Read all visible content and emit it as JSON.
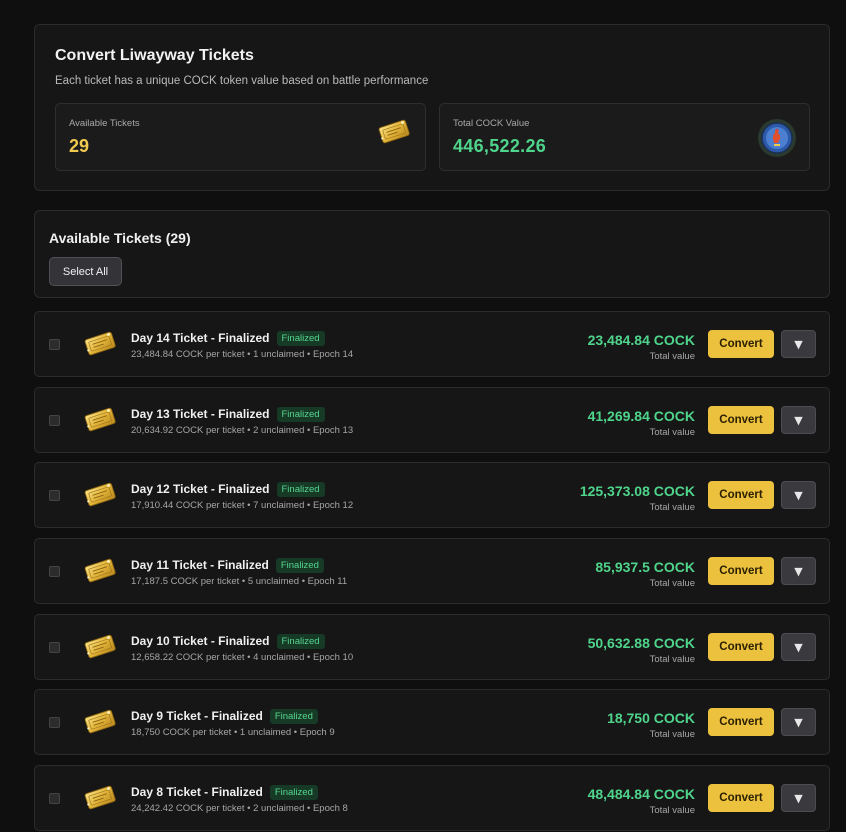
{
  "header": {
    "title": "Convert Liwayway Tickets",
    "subtitle": "Each ticket has a unique COCK token value based on battle performance",
    "available_label": "Available Tickets",
    "available_value": "29",
    "total_label": "Total COCK Value",
    "total_value": "446,522.26"
  },
  "list": {
    "title": "Available Tickets (29)",
    "select_all_label": "Select All"
  },
  "icons": {
    "ticket": "golden-ticket-icon",
    "token": "cock-token-icon",
    "expand": "chevron-down-icon"
  },
  "colors": {
    "accent": "#ecc13e",
    "value_green": "#4fd48b",
    "badge_bg": "#173a26",
    "background": "#0f0f0f"
  },
  "tickets": [
    {
      "name": "Day 14 Ticket - Finalized",
      "badge": "Finalized",
      "details": "23,484.84 COCK per ticket • 1 unclaimed • Epoch 14",
      "total": "23,484.84 COCK",
      "total_label": "Total value",
      "convert_label": "Convert",
      "expand_symbol": "▼"
    },
    {
      "name": "Day 13 Ticket - Finalized",
      "badge": "Finalized",
      "details": "20,634.92 COCK per ticket • 2 unclaimed • Epoch 13",
      "total": "41,269.84 COCK",
      "total_label": "Total value",
      "convert_label": "Convert",
      "expand_symbol": "▼"
    },
    {
      "name": "Day 12 Ticket - Finalized",
      "badge": "Finalized",
      "details": "17,910.44 COCK per ticket • 7 unclaimed • Epoch 12",
      "total": "125,373.08 COCK",
      "total_label": "Total value",
      "convert_label": "Convert",
      "expand_symbol": "▼"
    },
    {
      "name": "Day 11 Ticket - Finalized",
      "badge": "Finalized",
      "details": "17,187.5 COCK per ticket • 5 unclaimed • Epoch 11",
      "total": "85,937.5 COCK",
      "total_label": "Total value",
      "convert_label": "Convert",
      "expand_symbol": "▼"
    },
    {
      "name": "Day 10 Ticket - Finalized",
      "badge": "Finalized",
      "details": "12,658.22 COCK per ticket • 4 unclaimed • Epoch 10",
      "total": "50,632.88 COCK",
      "total_label": "Total value",
      "convert_label": "Convert",
      "expand_symbol": "▼"
    },
    {
      "name": "Day 9 Ticket - Finalized",
      "badge": "Finalized",
      "details": "18,750 COCK per ticket • 1 unclaimed • Epoch 9",
      "total": "18,750 COCK",
      "total_label": "Total value",
      "convert_label": "Convert",
      "expand_symbol": "▼"
    },
    {
      "name": "Day 8 Ticket - Finalized",
      "badge": "Finalized",
      "details": "24,242.42 COCK per ticket • 2 unclaimed • Epoch 8",
      "total": "48,484.84 COCK",
      "total_label": "Total value",
      "convert_label": "Convert",
      "expand_symbol": "▼"
    }
  ]
}
